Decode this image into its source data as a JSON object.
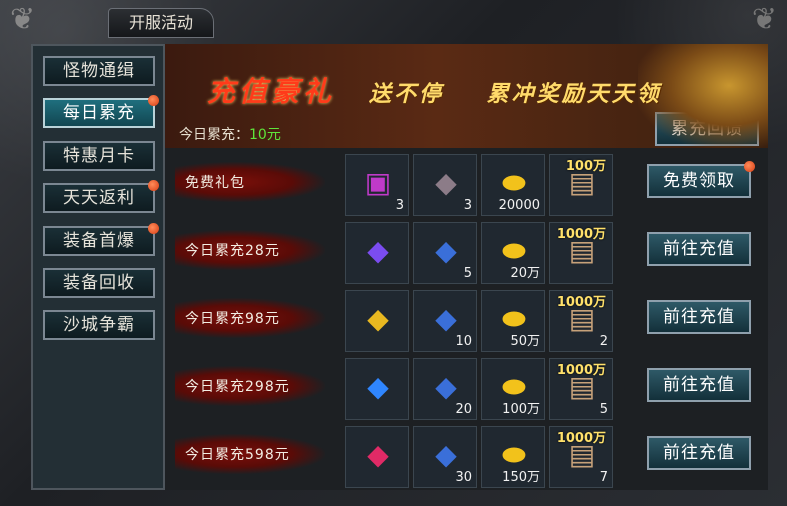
{
  "window": {
    "title": "开服活动"
  },
  "sidebar": {
    "items": [
      {
        "label": "怪物通缉",
        "active": false,
        "badge": false
      },
      {
        "label": "每日累充",
        "active": true,
        "badge": true
      },
      {
        "label": "特惠月卡",
        "active": false,
        "badge": false
      },
      {
        "label": "天天返利",
        "active": false,
        "badge": true
      },
      {
        "label": "装备首爆",
        "active": false,
        "badge": true
      },
      {
        "label": "装备回收",
        "active": false,
        "badge": false
      },
      {
        "label": "沙城争霸",
        "active": false,
        "badge": false
      }
    ]
  },
  "banner": {
    "title": "充值豪礼",
    "subtitle": "送不停    累冲奖励天天领",
    "today_label": "今日累充：",
    "today_value": "10元",
    "feedback_button": "累充回馈"
  },
  "rows": [
    {
      "label": "免费礼包",
      "button": "免费领取",
      "button_badge": true,
      "items": [
        {
          "icon": "treasure-chest-icon",
          "qty": "3",
          "top": ""
        },
        {
          "icon": "ore-stone-icon",
          "qty": "3",
          "top": ""
        },
        {
          "icon": "gold-ingot-icon",
          "qty": "20000",
          "top": ""
        },
        {
          "icon": "scroll-icon",
          "qty": "",
          "top": "100万"
        }
      ]
    },
    {
      "label": "今日累充28元",
      "button": "前往充值",
      "button_badge": false,
      "items": [
        {
          "icon": "purple-gem-icon",
          "qty": "",
          "top": ""
        },
        {
          "icon": "blue-crystal-icon",
          "qty": "5",
          "top": ""
        },
        {
          "icon": "gold-ingot-icon",
          "qty": "20万",
          "top": ""
        },
        {
          "icon": "scroll-icon",
          "qty": "",
          "top": "1000万"
        }
      ]
    },
    {
      "label": "今日累充98元",
      "button": "前往充值",
      "button_badge": false,
      "items": [
        {
          "icon": "yellow-gem-icon",
          "qty": "",
          "top": ""
        },
        {
          "icon": "blue-crystal-icon",
          "qty": "10",
          "top": ""
        },
        {
          "icon": "gold-ingot-icon",
          "qty": "50万",
          "top": ""
        },
        {
          "icon": "scroll-icon",
          "qty": "2",
          "top": "1000万"
        }
      ]
    },
    {
      "label": "今日累充298元",
      "button": "前往充值",
      "button_badge": false,
      "items": [
        {
          "icon": "blue-gem-icon",
          "qty": "",
          "top": ""
        },
        {
          "icon": "blue-crystal-icon",
          "qty": "20",
          "top": ""
        },
        {
          "icon": "gold-ingot-icon",
          "qty": "100万",
          "top": ""
        },
        {
          "icon": "scroll-icon",
          "qty": "5",
          "top": "1000万"
        }
      ]
    },
    {
      "label": "今日累充598元",
      "button": "前往充值",
      "button_badge": false,
      "items": [
        {
          "icon": "red-gem-icon",
          "qty": "",
          "top": ""
        },
        {
          "icon": "blue-crystal-icon",
          "qty": "30",
          "top": ""
        },
        {
          "icon": "gold-ingot-icon",
          "qty": "150万",
          "top": ""
        },
        {
          "icon": "scroll-icon",
          "qty": "7",
          "top": "1000万"
        }
      ]
    }
  ],
  "colors": {
    "accent_active": "#1f6f7e",
    "today_value": "#5fe43a",
    "banner_title": "#ff3b1a",
    "badge": "#d63b12"
  }
}
